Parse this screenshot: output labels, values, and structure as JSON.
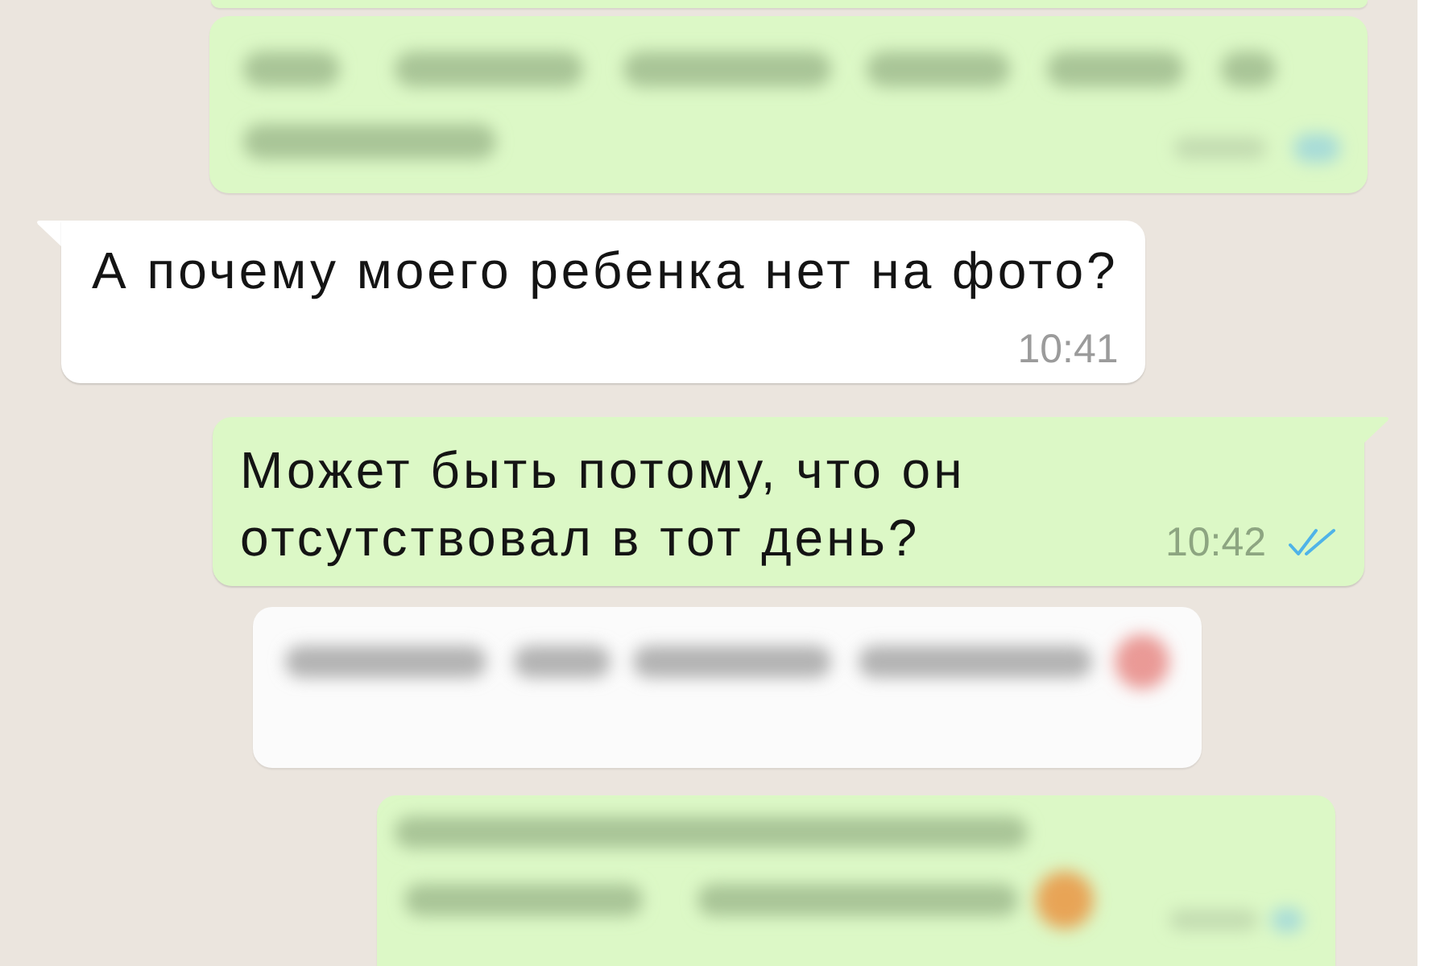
{
  "chat": {
    "messages": [
      {
        "kind": "blurred",
        "outgoing": true,
        "partly_hidden": true
      },
      {
        "kind": "blurred",
        "outgoing": true,
        "partly_hidden": false
      },
      {
        "kind": "text",
        "outgoing": false,
        "partly_hidden": false,
        "text": "А почему моего ребенка нет на фото?",
        "time": "10:41"
      },
      {
        "kind": "text",
        "outgoing": true,
        "partly_hidden": false,
        "text": "Может быть потому, что он отсутствовал в тот день?",
        "time": "10:42",
        "read": true
      },
      {
        "kind": "blurred",
        "outgoing": false,
        "partly_hidden": false
      },
      {
        "kind": "blurred",
        "outgoing": true,
        "partly_hidden": true
      }
    ]
  }
}
